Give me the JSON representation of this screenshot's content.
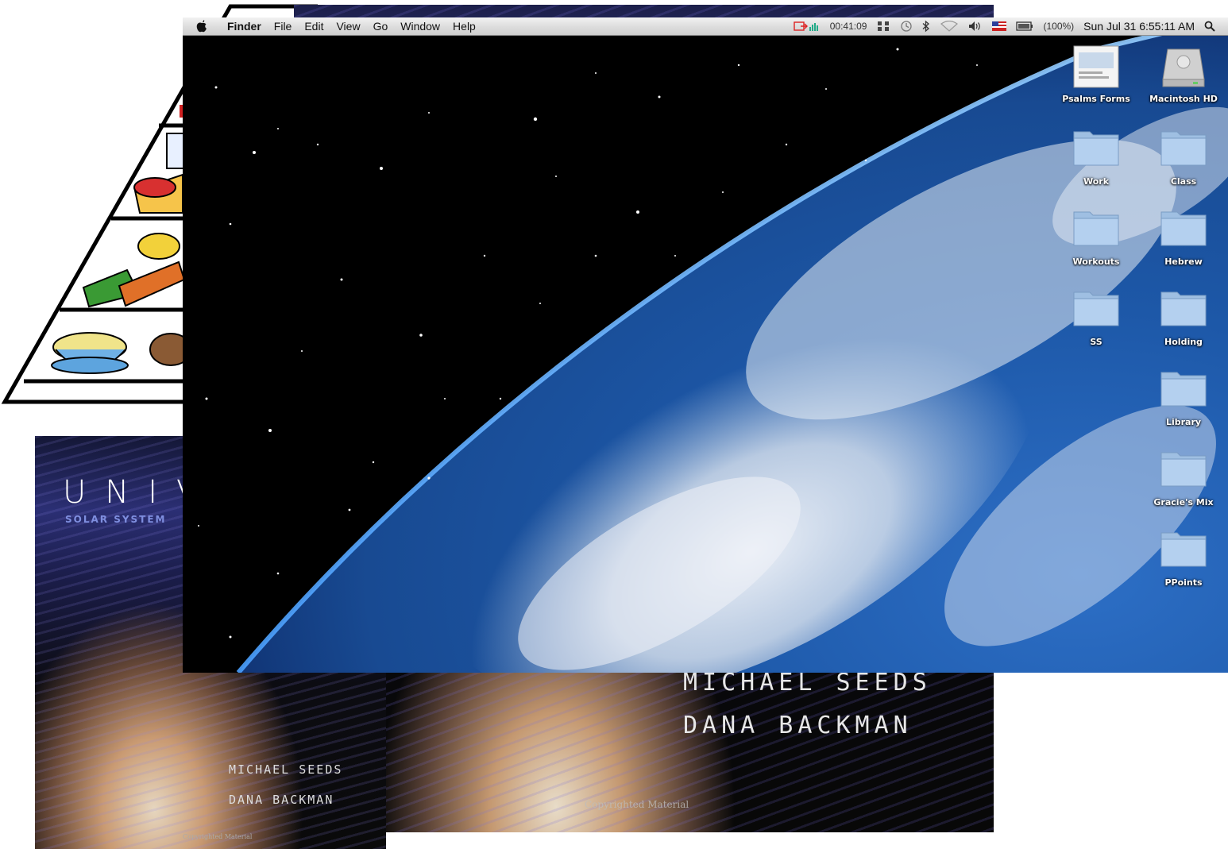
{
  "menubar": {
    "app_name": "Finder",
    "menus": [
      "File",
      "Edit",
      "View",
      "Go",
      "Window",
      "Help"
    ],
    "timer": "00:41:09",
    "battery": "(100%)",
    "clock": "Sun Jul 31  6:55:11 AM"
  },
  "desktop_icons": [
    {
      "label": "Psalms Forms",
      "icon": "document-thumbnail-icon"
    },
    {
      "label": "Macintosh HD",
      "icon": "hard-drive-icon"
    },
    {
      "label": "Work",
      "icon": "folder-icon"
    },
    {
      "label": "Class",
      "icon": "folder-icon"
    },
    {
      "label": "Workouts",
      "icon": "folder-icon"
    },
    {
      "label": "Hebrew",
      "icon": "folder-icon"
    },
    {
      "label": "SS",
      "icon": "folder-icon"
    },
    {
      "label": "Holding",
      "icon": "folder-icon"
    },
    {
      "label": "Library",
      "icon": "folder-icon"
    },
    {
      "label": "Gracie's Mix",
      "icon": "folder-icon"
    },
    {
      "label": "PPoints",
      "icon": "folder-icon"
    }
  ],
  "book_small": {
    "title": "UNIV",
    "subtitle": "SOLAR SYSTEM",
    "author1": "MICHAEL SEEDS",
    "author2": "DANA BACKMAN",
    "copyright": "Copyrighted Material"
  },
  "book_large": {
    "author1_clipped": "MICHAEL SEEDS",
    "author2": "DANA BACKMAN",
    "copyright": "Copyrighted Material"
  },
  "colors": {
    "menubar": "#dcdcdc",
    "space": "#000000",
    "ocean": "#1d5fb8",
    "folder": "#a9c6e6"
  }
}
